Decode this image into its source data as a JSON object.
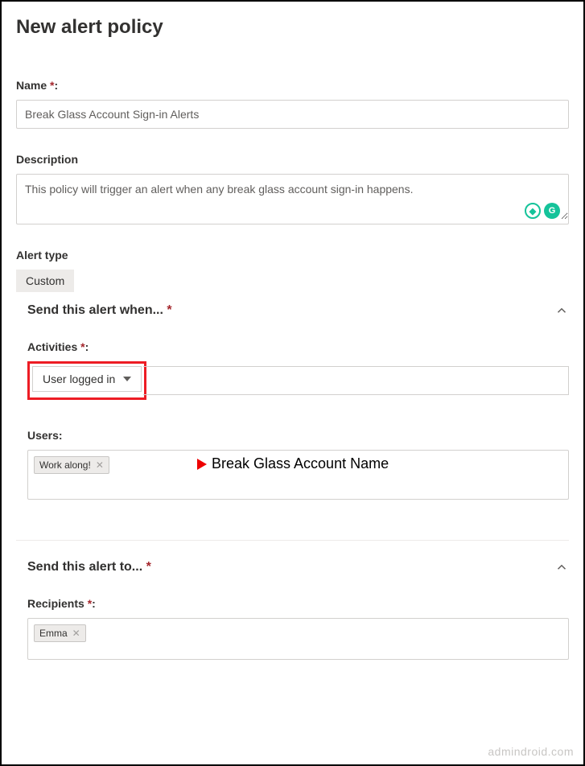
{
  "pageTitle": "New alert policy",
  "nameField": {
    "label": "Name ",
    "required": "*",
    "suffix": ":",
    "value": "Break Glass Account Sign-in Alerts"
  },
  "descriptionField": {
    "label": "Description",
    "value": "This policy will trigger an alert when any break glass account sign-in happens."
  },
  "alertType": {
    "label": "Alert type",
    "value": "Custom"
  },
  "sendWhen": {
    "title": "Send this alert when... ",
    "required": "*",
    "activities": {
      "label": "Activities ",
      "required": "*",
      "suffix": ":",
      "selected": "User logged in"
    },
    "users": {
      "label": "Users:",
      "tag": "Work along!",
      "annotation": "Break Glass Account Name"
    }
  },
  "sendTo": {
    "title": "Send this alert to... ",
    "required": "*",
    "recipients": {
      "label": "Recipients ",
      "required": "*",
      "suffix": ":",
      "tag": "Emma"
    }
  },
  "watermark": "admindroid.com"
}
